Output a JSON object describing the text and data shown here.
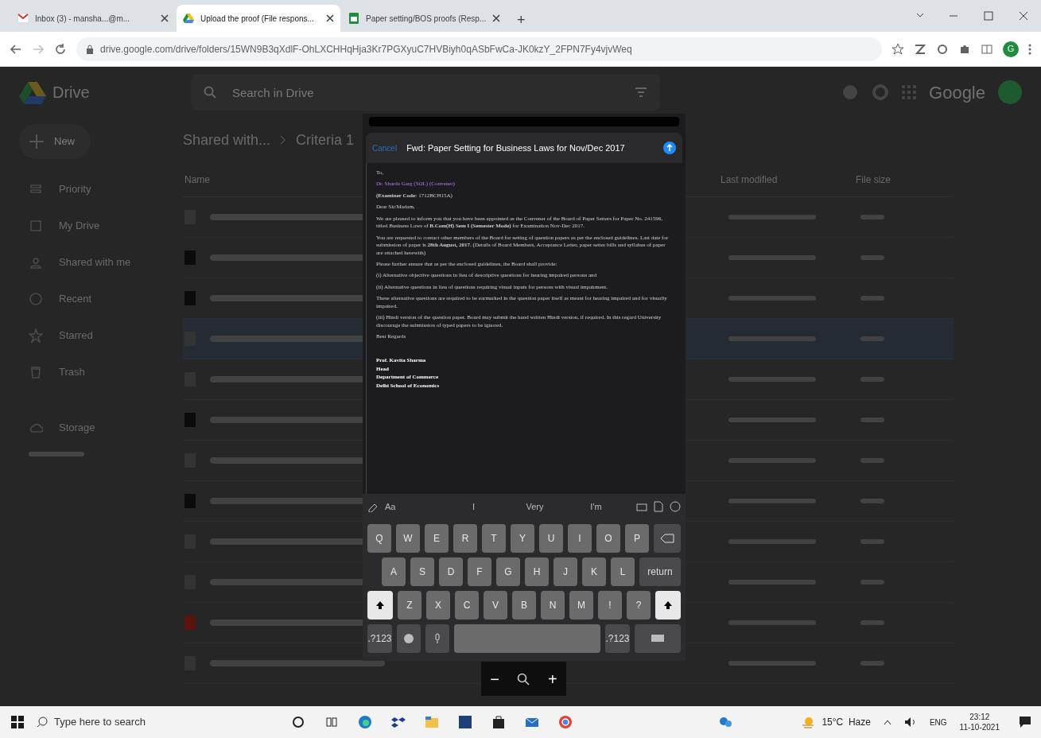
{
  "browser": {
    "tabs": [
      {
        "kind": "mail",
        "label": "Inbox (3) - mansha...@m...",
        "selected": false
      },
      {
        "kind": "drive",
        "label": "Upload the proof (File respons...",
        "selected": true
      },
      {
        "kind": "sheet",
        "label": "Paper setting/BOS proofs (Resp...",
        "selected": false
      }
    ],
    "new_tab": "+",
    "url": "drive.google.com/drive/folders/15WN9B3qXdlF-OhLXCHHqHja3Kr7PGXyuC7HVBiyh0qASbFwCa-JK0kzY_2FPN7Fy4vjvWeq",
    "profile": "G"
  },
  "drive": {
    "logo": "Drive",
    "search": {
      "placeholder": "Search in Drive"
    },
    "account": "Google",
    "new_button": "New",
    "nav": [
      {
        "kind": "priority",
        "label": "Priority",
        "selected": false
      },
      {
        "kind": "mydrive",
        "label": "My Drive",
        "selected": false
      },
      {
        "kind": "shared",
        "label": "Shared with me",
        "selected": false
      },
      {
        "kind": "recent",
        "label": "Recent",
        "selected": false
      },
      {
        "kind": "starred",
        "label": "Starred",
        "selected": false
      },
      {
        "kind": "trash",
        "label": "Trash",
        "selected": false
      },
      {
        "kind": "storage",
        "label": "Storage",
        "selected": false
      }
    ],
    "breadcrumb": [
      "Shared with...",
      "Criteria 1"
    ],
    "columns": [
      "Name",
      "Last modified",
      "File size"
    ],
    "rows": [
      {
        "kind": "doc",
        "selected": false
      },
      {
        "kind": "image",
        "selected": false
      },
      {
        "kind": "image",
        "selected": false
      },
      {
        "kind": "doc",
        "selected": true
      },
      {
        "kind": "doc",
        "selected": false
      },
      {
        "kind": "image",
        "selected": false
      },
      {
        "kind": "doc",
        "selected": false
      },
      {
        "kind": "image",
        "selected": false
      },
      {
        "kind": "doc",
        "selected": false
      },
      {
        "kind": "doc",
        "selected": false
      },
      {
        "kind": "pdf",
        "selected": false
      },
      {
        "kind": "doc",
        "selected": false
      }
    ]
  },
  "preview": {
    "cancel": "Cancel",
    "subject": "Fwd: Paper Setting for Business Laws for Nov/Dec 2017",
    "body": [
      {
        "kind": "plain",
        "text": "To,"
      },
      {
        "kind": "link",
        "text": "Dr. Sharda Garg (SOL) (Convener)"
      },
      {
        "kind": "plain",
        "text": "**(Examiner Code:** 1712BCH15A)"
      },
      {
        "kind": "plain",
        "text": "Dear Sir/Madam,"
      },
      {
        "kind": "plain",
        "text": "We are pleased to inform you that you have been appointed as the Convener of the Board of Paper Setters for Paper No. 241596, titled Business Laws of **B.Com(H) Sem I (Semester Mode)** for Examination Nov-Dec 2017."
      },
      {
        "kind": "plain",
        "text": "You are requested to contact other members of the Board for setting of question papers as per the enclosed guidelines. Last date for submission of paper is **28th August, 2017**. (Details of Board Members, Acceptance Letter, paper setter bills and syllabus of paper are attached herewith)"
      },
      {
        "kind": "plain",
        "text": "Please further ensure that as per the enclosed guidelines, the Board shall provide:"
      },
      {
        "kind": "plain",
        "text": "(i) Alternative objective questions in lieu of descriptive questions for hearing impaired persons and"
      },
      {
        "kind": "plain",
        "text": "(ii) Alternative questions in lieu of questions requiring visual inputs for persons with visual impairment."
      },
      {
        "kind": "plain",
        "text": "These alternative questions are required to be earmarked in the question paper itself as meant for hearing impaired and for visually impaired."
      },
      {
        "kind": "plain",
        "text": "(iii) Hindi version of the question paper. Board may submit the hand written Hindi version, if required. In this regard University discourage the submission of typed papers to be ignored."
      },
      {
        "kind": "plain",
        "text": "Best Regards"
      },
      {
        "kind": "signature",
        "text": "Prof. Kavita Sharma"
      },
      {
        "kind": "signature",
        "text": "Head"
      },
      {
        "kind": "signature",
        "text": "Department of Commerce"
      },
      {
        "kind": "signature",
        "text": "Delhi School of Economics"
      }
    ],
    "suggestions": [
      "Aa",
      "I",
      "Very",
      "I'm"
    ],
    "keys": [
      [
        {
          "kind": "letter",
          "label": "Q"
        },
        {
          "kind": "letter",
          "label": "W"
        },
        {
          "kind": "letter",
          "label": "E"
        },
        {
          "kind": "letter",
          "label": "R"
        },
        {
          "kind": "letter",
          "label": "T"
        },
        {
          "kind": "letter",
          "label": "Y"
        },
        {
          "kind": "letter",
          "label": "U"
        },
        {
          "kind": "letter",
          "label": "I"
        },
        {
          "kind": "letter",
          "label": "O"
        },
        {
          "kind": "letter",
          "label": "P"
        },
        {
          "kind": "delete"
        }
      ],
      [
        {
          "kind": "letter",
          "label": "A"
        },
        {
          "kind": "letter",
          "label": "S"
        },
        {
          "kind": "letter",
          "label": "D"
        },
        {
          "kind": "letter",
          "label": "F"
        },
        {
          "kind": "letter",
          "label": "G"
        },
        {
          "kind": "letter",
          "label": "H"
        },
        {
          "kind": "letter",
          "label": "J"
        },
        {
          "kind": "letter",
          "label": "K"
        },
        {
          "kind": "letter",
          "label": "L"
        },
        {
          "kind": "wide",
          "label": "return"
        }
      ],
      [
        {
          "kind": "shift"
        },
        {
          "kind": "letter",
          "label": "Z"
        },
        {
          "kind": "letter",
          "label": "X"
        },
        {
          "kind": "letter",
          "label": "C"
        },
        {
          "kind": "letter",
          "label": "V"
        },
        {
          "kind": "letter",
          "label": "B"
        },
        {
          "kind": "letter",
          "label": "N"
        },
        {
          "kind": "letter",
          "label": "M"
        },
        {
          "kind": "letter",
          "label": "!"
        },
        {
          "kind": "letter",
          "label": "?"
        },
        {
          "kind": "shift"
        }
      ],
      [
        {
          "kind": "wide",
          "label": ".?123"
        },
        {
          "kind": "globe"
        },
        {
          "kind": "mic"
        },
        {
          "kind": "space"
        },
        {
          "kind": "wide",
          "label": ".?123"
        },
        {
          "kind": "hide"
        }
      ]
    ],
    "zoom": {
      "minus": "−",
      "plus": "+"
    }
  },
  "taskbar": {
    "search": "Type here to search",
    "weather": "15°C  Haze",
    "lang": "ENG",
    "time": "23:12",
    "date": "11-10-2021"
  }
}
